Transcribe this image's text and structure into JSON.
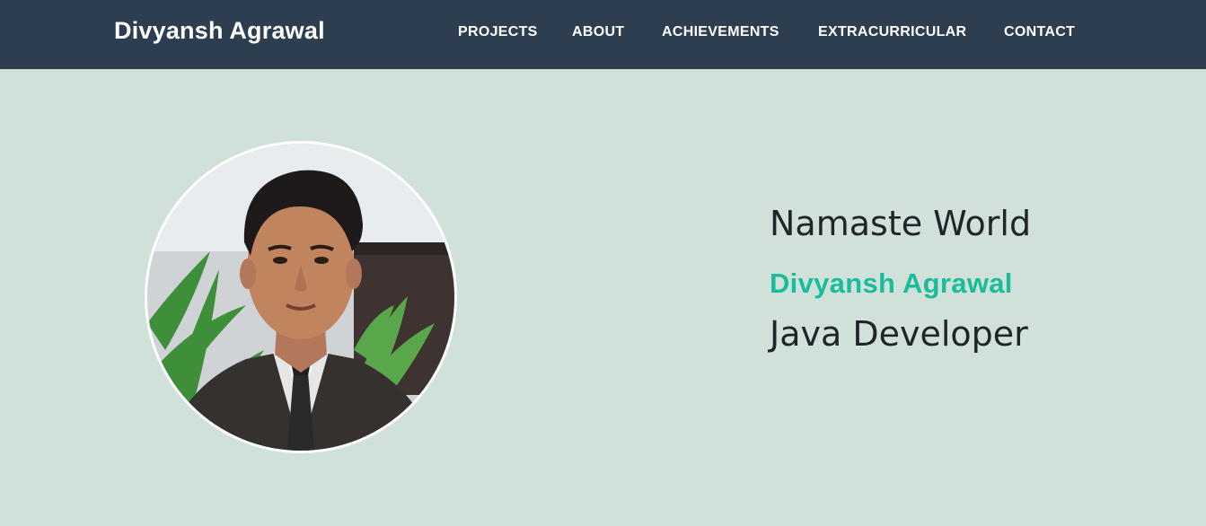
{
  "header": {
    "brand": "Divyansh Agrawal",
    "nav": [
      {
        "label": "PROJECTS"
      },
      {
        "label": "ABOUT"
      },
      {
        "label": "ACHIEVEMENTS"
      },
      {
        "label": "EXTRACURRICULAR"
      },
      {
        "label": "CONTACT"
      }
    ]
  },
  "hero": {
    "greeting": "Namaste World",
    "name": "Divyansh Agrawal",
    "role": "Java Developer"
  },
  "colors": {
    "navbar": "#2c3e50",
    "background": "#d0e1d9",
    "accent": "#1abc9c",
    "text": "#212529"
  }
}
